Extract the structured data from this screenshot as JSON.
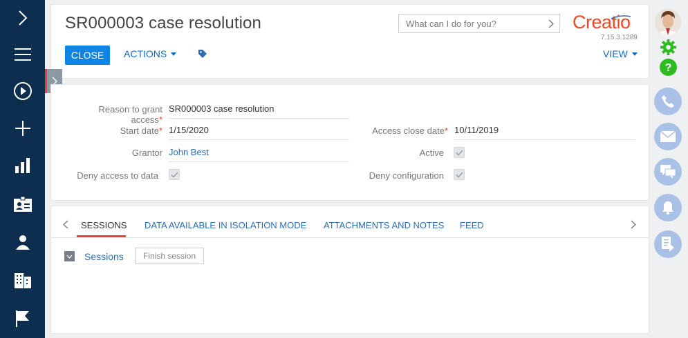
{
  "header": {
    "title": "SR000003 case resolution",
    "close_label": "CLOSE",
    "actions_label": "ACTIONS",
    "view_label": "VIEW",
    "search_placeholder": "What can I do for you?",
    "logo_text": "Creatio",
    "version": "7.15.3.1289"
  },
  "fields": {
    "reason_label": "Reason to grant access",
    "reason_value": "SR000003 case resolution",
    "start_date_label": "Start date",
    "start_date_value": "1/15/2020",
    "access_close_label": "Access close date",
    "access_close_value": "10/11/2019",
    "grantor_label": "Grantor",
    "grantor_value": "John Best",
    "active_label": "Active",
    "active_checked": true,
    "deny_access_label": "Deny access to data",
    "deny_access_checked": true,
    "deny_config_label": "Deny configuration",
    "deny_config_checked": true,
    "required_mark": "*"
  },
  "tabs": [
    {
      "label": "SESSIONS",
      "active": true
    },
    {
      "label": "DATA AVAILABLE IN ISOLATION MODE",
      "active": false
    },
    {
      "label": "ATTACHMENTS AND NOTES",
      "active": false
    },
    {
      "label": "FEED",
      "active": false
    }
  ],
  "sessions": {
    "title": "Sessions",
    "finish_label": "Finish session"
  },
  "left_nav": [
    "chevron-right-icon",
    "menu-icon",
    "play-icon",
    "plus-icon",
    "bar-chart-icon",
    "contact-card-icon",
    "user-icon",
    "building-icon",
    "flag-icon"
  ],
  "right_nav": [
    "avatar",
    "gear-icon",
    "help-icon",
    "phone-icon",
    "mail-icon",
    "chat-icon",
    "bell-icon",
    "document-icon"
  ],
  "colors": {
    "sidebar": "#0d2e4e",
    "primary": "#0e84e5",
    "link": "#2c6cb4",
    "accent": "#e8452c",
    "gear": "#2dbb1f",
    "right_circles": "#a9c1e6"
  }
}
